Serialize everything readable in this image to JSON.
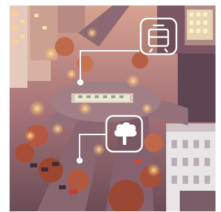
{
  "scene": {
    "subject": "aerial-view-city-square-at-dusk",
    "palette": {
      "sky": "#d9a38a",
      "buildings_warm": "#c98a74",
      "buildings_dark": "#6e4b57",
      "street_lights": "#ffd27a",
      "road": "#8a6670",
      "trees": "#b4583f",
      "white_facade": "#e9e4e6"
    }
  },
  "callouts": [
    {
      "id": "tram",
      "icon": "tram-icon",
      "stroke": "#ffffff"
    },
    {
      "id": "tree",
      "icon": "tree-icon",
      "stroke": "#ffffff"
    }
  ]
}
